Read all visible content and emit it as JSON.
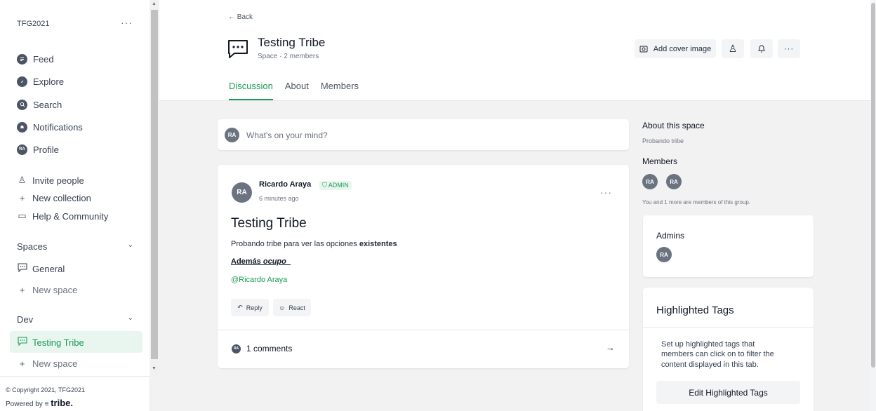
{
  "sidebar": {
    "community": "TFG2021",
    "more": "···",
    "nav": [
      {
        "label": "Feed",
        "icon": "feed-icon"
      },
      {
        "label": "Explore",
        "icon": "explore-icon"
      },
      {
        "label": "Search",
        "icon": "search-icon"
      },
      {
        "label": "Notifications",
        "icon": "bell-icon"
      },
      {
        "label": "Profile",
        "icon": "avatar",
        "initials": "RA"
      }
    ],
    "actions": [
      {
        "label": "Invite people",
        "glyph": "♙"
      },
      {
        "label": "New collection",
        "glyph": "+"
      },
      {
        "label": "Help & Community",
        "glyph": "▭"
      }
    ],
    "sections": [
      {
        "label": "Spaces",
        "items": [
          {
            "label": "General"
          }
        ],
        "new": "New space"
      },
      {
        "label": "Dev",
        "items": [
          {
            "label": "Testing Tribe"
          }
        ],
        "new": "New space"
      }
    ],
    "footer": {
      "copyright": "© Copyright 2021, TFG2021",
      "powered": "Powered by",
      "brand": "tribe."
    }
  },
  "header": {
    "back": "← Back",
    "title": "Testing Tribe",
    "subtitle": "Space · 2 members",
    "cover_button": "Add cover image",
    "tabs": [
      "Discussion",
      "About",
      "Members"
    ]
  },
  "composer": {
    "initials": "RA",
    "placeholder": "What's on your mind?"
  },
  "post": {
    "initials": "RA",
    "author": "Ricardo Araya",
    "badge": "ADMIN",
    "time": "6 minutes ago",
    "title": "Testing Tribe",
    "body_prefix": "Probando tribe para ver las opciones",
    "body_bold": "existentes",
    "line2_bold": "Además",
    "line2_italic": "ocupo",
    "mention": "@Ricardo Araya",
    "reply": "Reply",
    "react": "React",
    "comments": "1 comments",
    "comment_initials": "RA"
  },
  "right": {
    "about_title": "About this space",
    "about_sub": "Probando tribe",
    "members_title": "Members",
    "members": [
      "RA",
      "RA"
    ],
    "members_note": "You and 1 more are members of this group.",
    "admins_title": "Admins",
    "admins": [
      "RA"
    ],
    "tags_title": "Highlighted Tags",
    "tags_desc": "Set up highlighted tags that members can click on to filter the content displayed in this tab.",
    "tags_button": "Edit Highlighted Tags"
  },
  "colors": {
    "accent": "#1a9b55",
    "active_bg": "#e9f6ef",
    "avatar": "#6b7280"
  }
}
